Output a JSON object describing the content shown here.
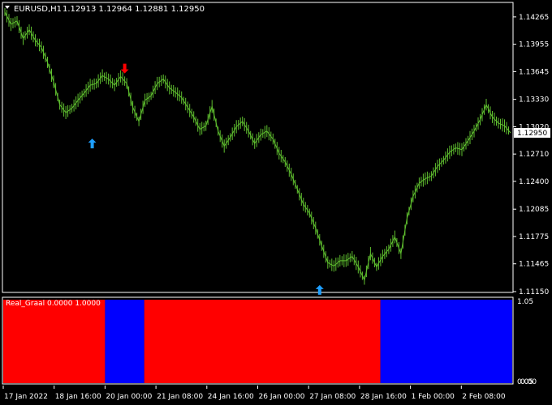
{
  "header": {
    "symbol": "EURUSD,H1",
    "ohlc": "1.12913 1.12964 1.12881 1.12950",
    "menu_icon": "triangle-down-icon"
  },
  "indicator": {
    "label": "Real_Graal 0.0000 1.0000",
    "scale_top": "1.05",
    "scale_bottom": "0.05",
    "scale_bottom2": "0.00",
    "colors": {
      "up": "#0000ff",
      "down": "#ff0000"
    },
    "segments": [
      {
        "state": "down",
        "start": 0.0,
        "end": 0.2
      },
      {
        "state": "up",
        "start": 0.2,
        "end": 0.277
      },
      {
        "state": "down",
        "start": 0.277,
        "end": 0.741
      },
      {
        "state": "up",
        "start": 0.741,
        "end": 1.0
      }
    ]
  },
  "chart_data": {
    "type": "line",
    "title": "",
    "xlabel": "",
    "ylabel": "",
    "ylim": [
      1.1115,
      1.1442
    ],
    "series_color": "#5fbf2f",
    "price_ticks": [
      "1.14265",
      "1.13955",
      "1.13645",
      "1.13330",
      "1.13020",
      "1.12710",
      "1.12400",
      "1.12085",
      "1.11775",
      "1.11465",
      "1.11150"
    ],
    "price_tick_values": [
      1.14265,
      1.13955,
      1.13645,
      1.1333,
      1.1302,
      1.1271,
      1.124,
      1.12085,
      1.11775,
      1.11465,
      1.1115
    ],
    "current_price": "1.12950",
    "current_price_value": 1.1295,
    "time_ticks": [
      "17 Jan 2022",
      "18 Jan 16:00",
      "20 Jan 00:00",
      "21 Jan 08:00",
      "24 Jan 16:00",
      "26 Jan 00:00",
      "27 Jan 08:00",
      "28 Jan 16:00",
      "1 Feb 00:00",
      "2 Feb 08:00"
    ],
    "x": [
      0,
      3,
      6,
      9,
      12,
      15,
      18,
      21,
      24,
      27,
      30,
      33,
      36,
      39,
      42,
      45,
      48,
      51,
      54,
      57,
      60,
      63,
      66,
      69,
      72,
      75,
      78,
      81,
      84,
      87,
      90,
      93,
      96,
      99,
      102,
      105,
      108,
      111,
      114,
      117,
      120,
      123,
      126,
      129,
      132,
      135,
      138,
      141,
      144,
      147,
      150,
      153,
      156,
      159,
      162,
      165,
      168,
      171,
      174,
      177,
      180,
      183,
      186,
      189,
      192,
      195,
      198,
      201,
      204,
      207,
      210,
      213
    ],
    "values": [
      1.1432,
      1.1418,
      1.1422,
      1.1402,
      1.1412,
      1.14,
      1.1392,
      1.1375,
      1.1353,
      1.1327,
      1.1318,
      1.1323,
      1.1332,
      1.134,
      1.1349,
      1.1351,
      1.136,
      1.1356,
      1.1349,
      1.1359,
      1.1351,
      1.1324,
      1.1308,
      1.1332,
      1.1337,
      1.1351,
      1.1356,
      1.1346,
      1.1341,
      1.1335,
      1.1324,
      1.1313,
      1.1299,
      1.1303,
      1.1325,
      1.1297,
      1.128,
      1.129,
      1.1302,
      1.1308,
      1.1297,
      1.1283,
      1.1293,
      1.1297,
      1.1288,
      1.1272,
      1.1262,
      1.1248,
      1.1231,
      1.1214,
      1.1204,
      1.1187,
      1.1167,
      1.1148,
      1.1144,
      1.115,
      1.115,
      1.1155,
      1.1143,
      1.1128,
      1.1158,
      1.1143,
      1.1155,
      1.1163,
      1.1177,
      1.1158,
      1.1198,
      1.1223,
      1.1238,
      1.1243,
      1.1246,
      1.1257
    ],
    "x_tail": [
      216,
      219,
      222,
      225,
      228,
      231,
      234
    ],
    "values_tail": [
      1.1264,
      1.1273,
      1.1278,
      1.1276,
      1.1286,
      1.1297,
      1.131
    ],
    "x_end": [
      237,
      240,
      243,
      246,
      249
    ],
    "values_end": [
      1.1327,
      1.1313,
      1.1306,
      1.1303,
      1.1295
    ],
    "arrows": [
      {
        "name": "up-arrow-icon",
        "direction": "up",
        "x": 43,
        "value": 1.1283
      },
      {
        "name": "down-arrow-icon",
        "direction": "down",
        "x": 59,
        "value": 1.1368
      },
      {
        "name": "up-arrow-icon",
        "direction": "up",
        "x": 155,
        "value": 1.1117
      }
    ],
    "arrow_colors": {
      "up": "#1e9fff",
      "down": "#ff0000"
    }
  }
}
